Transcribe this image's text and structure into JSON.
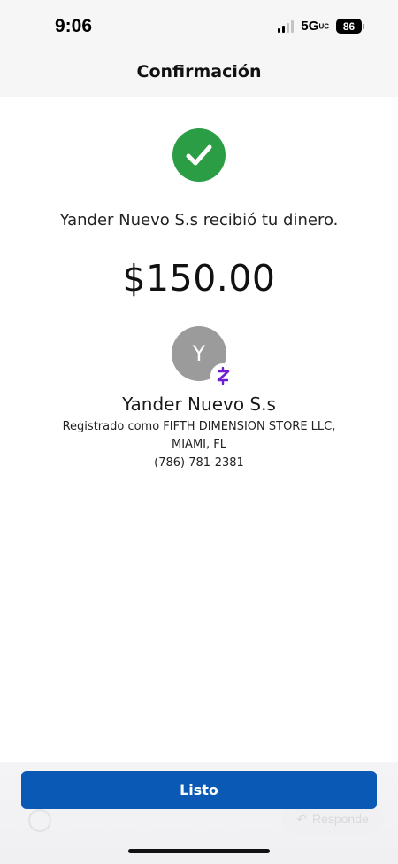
{
  "status_bar": {
    "time": "9:06",
    "network": "5G",
    "network_suffix": "UC",
    "battery": "86"
  },
  "header": {
    "title": "Confirmación"
  },
  "confirmation": {
    "icon": "check-circle-icon",
    "accent_color": "#2a9d45",
    "message": "Yander Nuevo  S.s recibió tu dinero.",
    "amount": "$150.00"
  },
  "recipient": {
    "avatar_initial": "Y",
    "badge_icon": "zelle-icon",
    "badge_color": "#6d1ed4",
    "name": "Yander Nuevo  S.s",
    "registered_as": "Registrado como FIFTH DIMENSION STORE LLC,",
    "location": "MIAMI, FL",
    "phone": "(786) 781-2381"
  },
  "actions": {
    "done_label": "Listo",
    "done_color": "#0a5ab5"
  },
  "background_overlay": {
    "reply_label": "Responde"
  }
}
